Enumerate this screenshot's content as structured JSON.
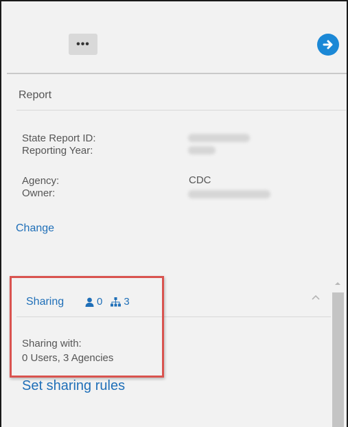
{
  "toolbar": {
    "more_label": "•••"
  },
  "report": {
    "section_title": "Report",
    "fields": {
      "state_report_id_label": "State Report ID:",
      "reporting_year_label": "Reporting Year:",
      "agency_label": "Agency:",
      "agency_value": "CDC",
      "owner_label": "Owner:"
    },
    "change_label": "Change"
  },
  "sharing": {
    "title": "Sharing",
    "users_count": "0",
    "agencies_count": "3",
    "sharing_with_label": "Sharing with:",
    "sharing_with_value": "0 Users, 3 Agencies",
    "set_rules_label": "Set sharing rules"
  },
  "colors": {
    "link": "#1f6fb8",
    "accent": "#1b88d6",
    "highlight": "#d9534f"
  },
  "icons": [
    "more-icon",
    "arrow-right-icon",
    "user-icon",
    "agencies-icon",
    "chevron-up-icon"
  ]
}
